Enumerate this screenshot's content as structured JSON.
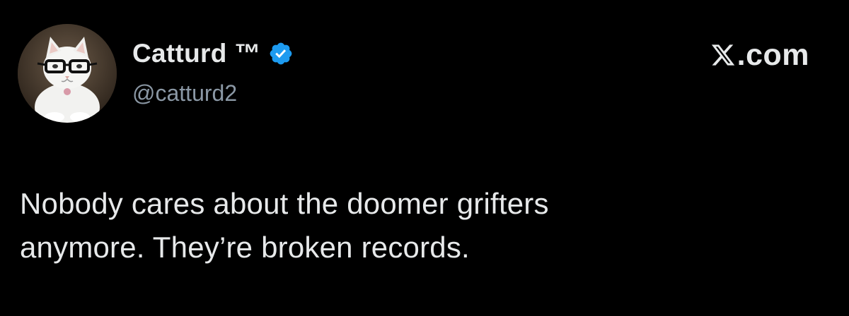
{
  "author": {
    "display_name": "Catturd ™",
    "handle": "@catturd2",
    "verified": true,
    "avatar_icon": "cat-with-glasses-avatar"
  },
  "brand": {
    "logo_icon": "x-logo-icon",
    "suffix": ".com"
  },
  "tweet": {
    "lines": [
      "Nobody cares about the doomer grifters",
      "anymore. They’re broken records."
    ]
  },
  "colors": {
    "background": "#000000",
    "primary_text": "#e7e9ea",
    "secondary_text": "#8b98a5",
    "verified_blue": "#1d9bf0"
  }
}
